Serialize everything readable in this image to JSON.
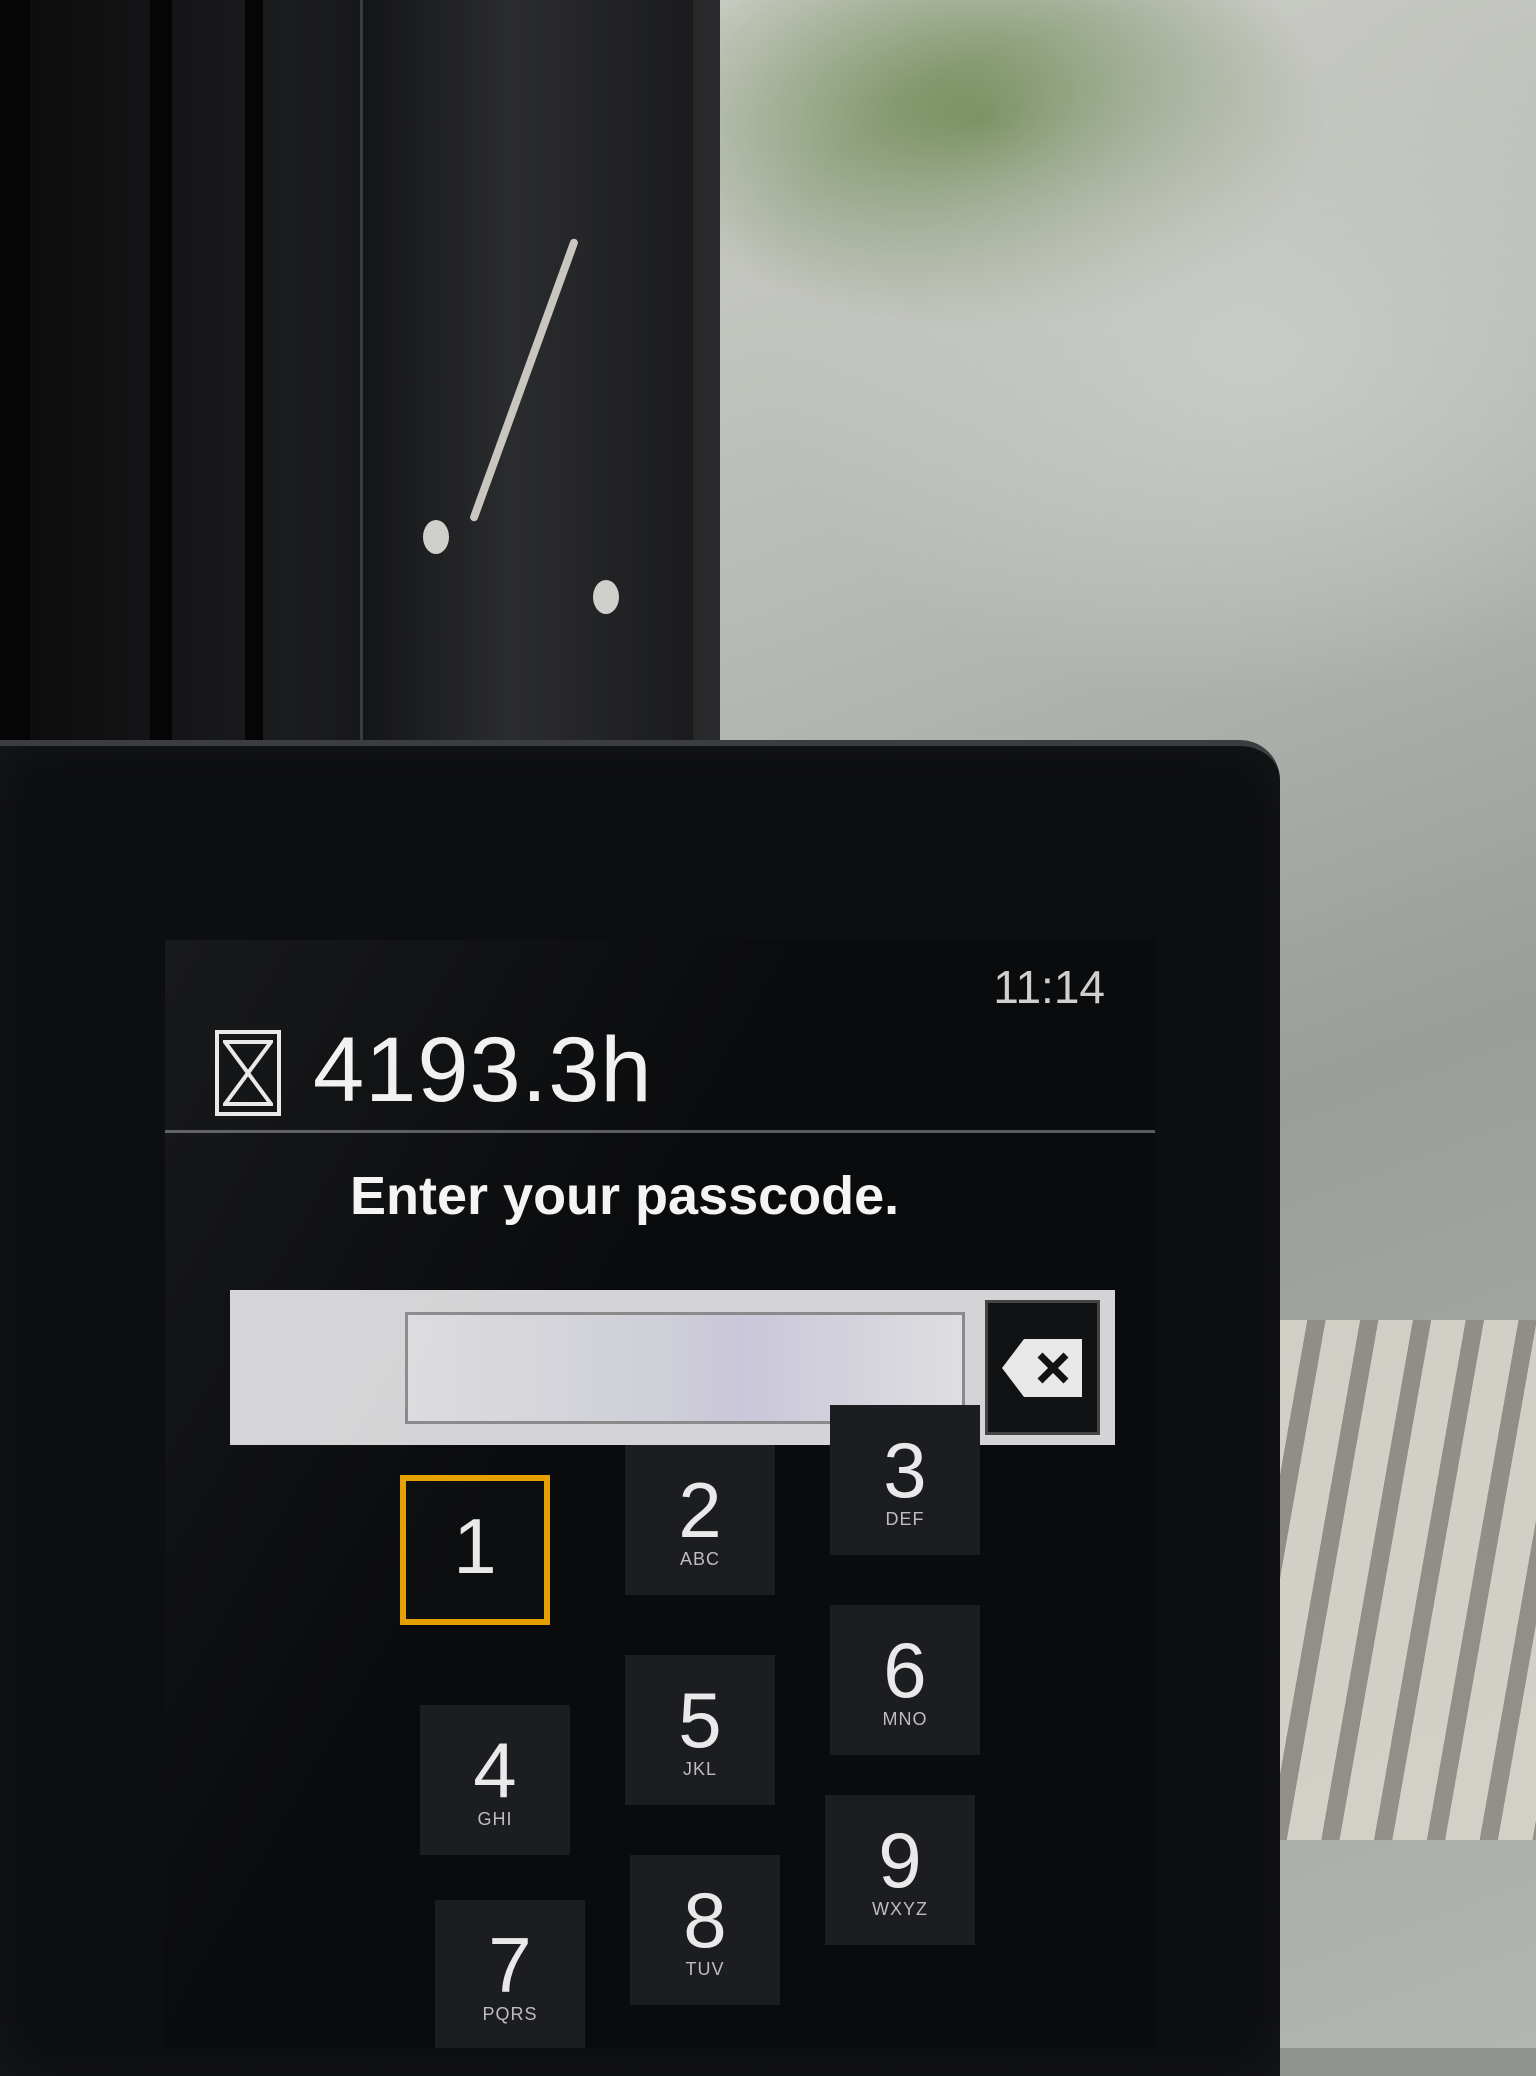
{
  "status_bar": {
    "hour_meter_icon": "hourglass-icon",
    "hour_meter_value": "4193.3h",
    "clock": "11:14"
  },
  "passcode": {
    "prompt": "Enter your passcode.",
    "value": "",
    "backspace_icon": "backspace-icon"
  },
  "keypad": [
    {
      "digit": "1",
      "letters": "",
      "selected": true
    },
    {
      "digit": "2",
      "letters": "ABC"
    },
    {
      "digit": "3",
      "letters": "DEF"
    },
    {
      "digit": "4",
      "letters": "GHI"
    },
    {
      "digit": "5",
      "letters": "JKL"
    },
    {
      "digit": "6",
      "letters": "MNO"
    },
    {
      "digit": "7",
      "letters": "PQRS"
    },
    {
      "digit": "8",
      "letters": "TUV"
    },
    {
      "digit": "9",
      "letters": "WXYZ"
    }
  ],
  "colors": {
    "selection_accent": "#e6a100",
    "screen_background": "#0a0b0d",
    "entry_bar": "#d4d4d6"
  }
}
